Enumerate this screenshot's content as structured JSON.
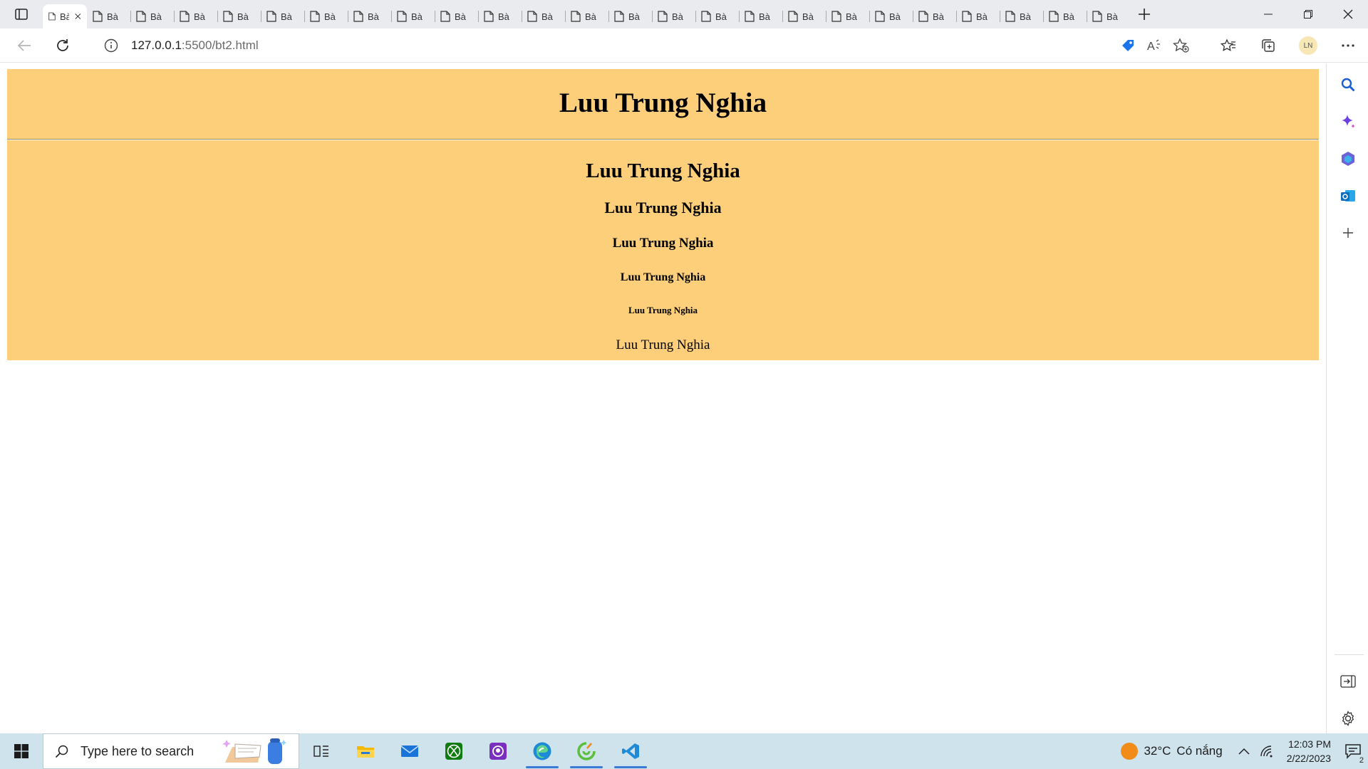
{
  "browser": {
    "tabs": [
      {
        "label": "Bài",
        "active": true
      },
      {
        "label": "Bà"
      },
      {
        "label": "Bà"
      },
      {
        "label": "Bà"
      },
      {
        "label": "Bà"
      },
      {
        "label": "Bà"
      },
      {
        "label": "Bà"
      },
      {
        "label": "Bà"
      },
      {
        "label": "Bà"
      },
      {
        "label": "Bà"
      },
      {
        "label": "Bà"
      },
      {
        "label": "Bà"
      },
      {
        "label": "Bà"
      },
      {
        "label": "Bà"
      },
      {
        "label": "Bà"
      },
      {
        "label": "Bà"
      },
      {
        "label": "Bà"
      },
      {
        "label": "Bà"
      },
      {
        "label": "Bà"
      },
      {
        "label": "Bà"
      },
      {
        "label": "Bà"
      },
      {
        "label": "Bà"
      },
      {
        "label": "Bà"
      },
      {
        "label": "Bà"
      },
      {
        "label": "Bà"
      }
    ],
    "url_host": "127.0.0.1",
    "url_rest": ":5500/bt2.html",
    "profile_initials": "LN"
  },
  "page": {
    "h1": "Luu Trung Nghia",
    "h2": "Luu Trung Nghia",
    "h3": "Luu Trung Nghia",
    "h4": "Luu Trung Nghia",
    "h5": "Luu Trung Nghia",
    "h6": "Luu Trung Nghia",
    "p": "Luu Trung Nghia",
    "background_color": "#fdcf7a"
  },
  "taskbar": {
    "search_placeholder": "Type here to search",
    "weather_temp": "32°C",
    "weather_text": "Có nắng",
    "time": "12:03 PM",
    "date": "2/22/2023",
    "notification_count": "2"
  }
}
